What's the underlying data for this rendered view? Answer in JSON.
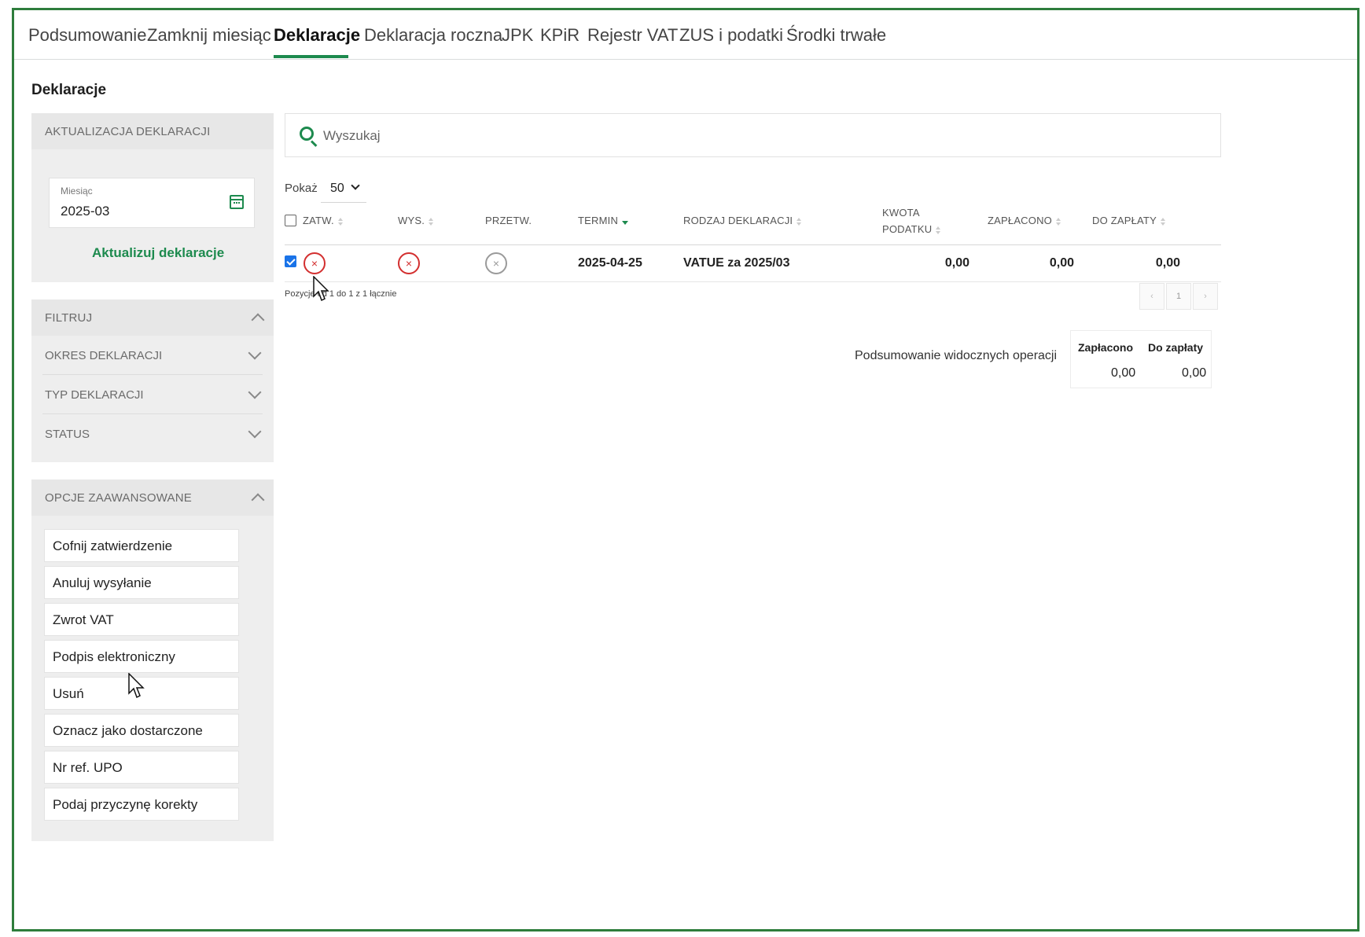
{
  "tabs": [
    {
      "label": "Podsumowanie"
    },
    {
      "label": "Zamknij miesiąc"
    },
    {
      "label": "Deklaracje"
    },
    {
      "label": "Deklaracja roczna"
    },
    {
      "label": "JPK"
    },
    {
      "label": "KPiR"
    },
    {
      "label": "Rejestr VAT"
    },
    {
      "label": "ZUS i podatki"
    },
    {
      "label": "Środki trwałe"
    }
  ],
  "page": {
    "title": "Deklaracje"
  },
  "update_panel": {
    "title": "AKTUALIZACJA DEKLARACJI",
    "month_label": "Miesiąc",
    "month_value": "2025-03",
    "action": "Aktualizuj deklaracje"
  },
  "filters": {
    "title": "FILTRUJ",
    "items": [
      {
        "label": "OKRES DEKLARACJI"
      },
      {
        "label": "TYP DEKLARACJI"
      },
      {
        "label": "STATUS"
      }
    ]
  },
  "advanced": {
    "title": "OPCJE ZAAWANSOWANE",
    "buttons": [
      {
        "label": "Cofnij zatwierdzenie"
      },
      {
        "label": "Anuluj wysyłanie"
      },
      {
        "label": "Zwrot VAT"
      },
      {
        "label": "Podpis elektroniczny"
      },
      {
        "label": "Usuń"
      },
      {
        "label": "Oznacz jako dostarczone"
      },
      {
        "label": "Nr ref. UPO"
      },
      {
        "label": "Podaj przyczynę korekty"
      }
    ]
  },
  "search": {
    "placeholder": "Wyszukaj"
  },
  "page_size": {
    "label": "Pokaż",
    "value": "50"
  },
  "table": {
    "headers": {
      "zatw": "ZATW.",
      "wys": "WYS.",
      "przetw": "PRZETW.",
      "termin": "TERMIN",
      "rodzaj": "RODZAJ DEKLARACJI",
      "kwota_1": "KWOTA",
      "kwota_2": "PODATKU",
      "zaplacono": "ZAPŁACONO",
      "do_zaplaty": "DO ZAPŁATY"
    },
    "rows": [
      {
        "selected": true,
        "zatw": "rejected",
        "wys": "rejected",
        "przetw": "not-processed",
        "termin": "2025-04-25",
        "rodzaj": "VATUE za 2025/03",
        "kwota": "0,00",
        "zaplacono": "0,00",
        "do_zaplaty": "0,00"
      }
    ],
    "status_glyph": "×",
    "positions": "Pozycje od 1 do 1 z 1 łącznie"
  },
  "pagination": {
    "prev": "‹",
    "page": "1",
    "next": "›"
  },
  "summary": {
    "label": "Podsumowanie widocznych operacji",
    "paid_label": "Zapłacono",
    "due_label": "Do zapłaty",
    "paid_value": "0,00",
    "due_value": "0,00"
  },
  "colors": {
    "accent": "#1d8a4e",
    "error": "#d32f2f",
    "frame": "#2e7d3c"
  }
}
